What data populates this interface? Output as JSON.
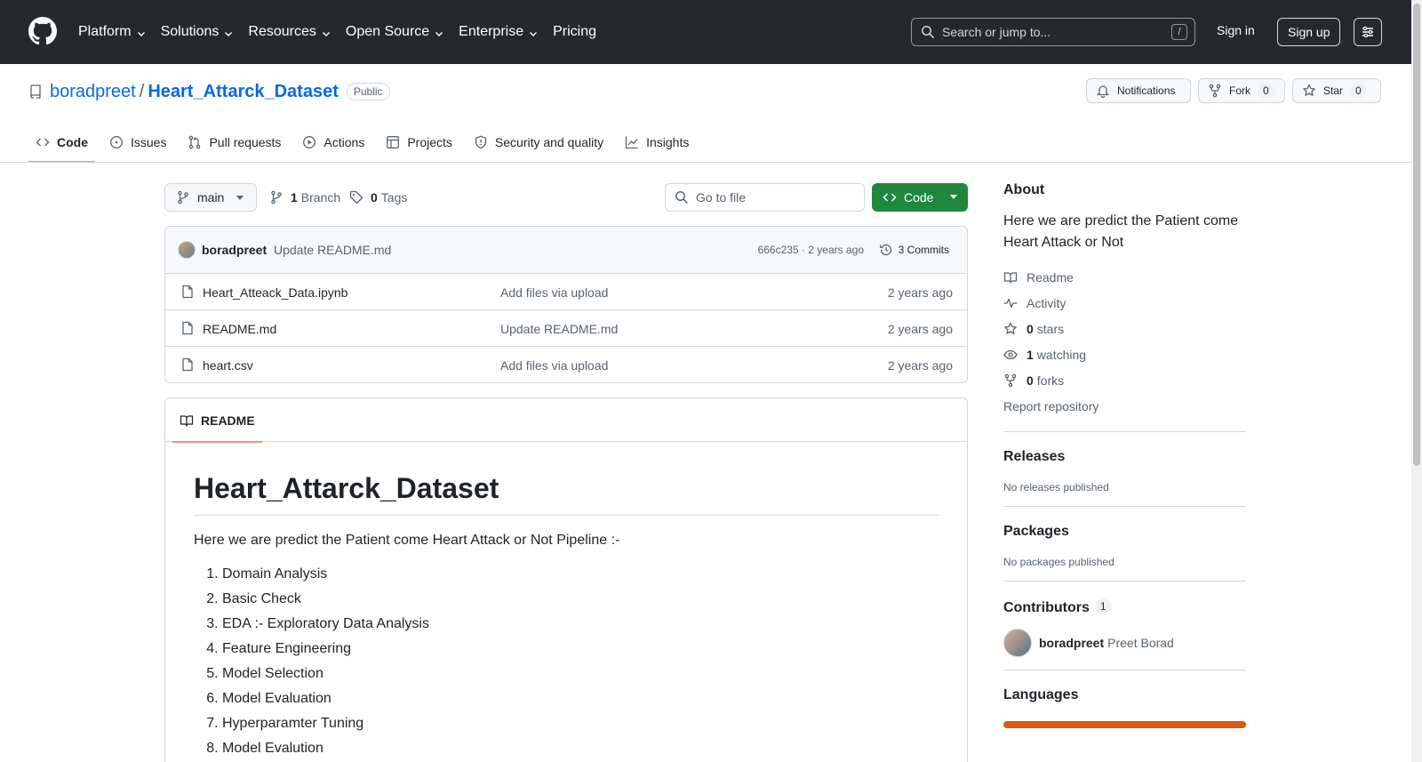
{
  "header": {
    "nav": [
      "Platform",
      "Solutions",
      "Resources",
      "Open Source",
      "Enterprise",
      "Pricing"
    ],
    "search_placeholder": "Search or jump to...",
    "search_key": "/",
    "sign_in": "Sign in",
    "sign_up": "Sign up"
  },
  "repo": {
    "owner": "boradpreet",
    "separator": "/",
    "name": "Heart_Attarck_Dataset",
    "visibility": "Public",
    "notifications": "Notifications",
    "fork_label": "Fork",
    "fork_count": "0",
    "star_label": "Star",
    "star_count": "0"
  },
  "tabs": [
    "Code",
    "Issues",
    "Pull requests",
    "Actions",
    "Projects",
    "Security and quality",
    "Insights"
  ],
  "branch": {
    "name": "main",
    "branch_count": "1",
    "branch_label": "Branch",
    "tag_count": "0",
    "tag_label": "Tags",
    "goto_placeholder": "Go to file",
    "code_button": "Code"
  },
  "commit": {
    "author": "boradpreet",
    "message": "Update README.md",
    "hash_time": "666c235 · 2 years ago",
    "commits": "3 Commits"
  },
  "files": [
    {
      "name": "Heart_Atteack_Data.ipynb",
      "commit": "Add files via upload",
      "age": "2 years ago"
    },
    {
      "name": "README.md",
      "commit": "Update README.md",
      "age": "2 years ago"
    },
    {
      "name": "heart.csv",
      "commit": "Add files via upload",
      "age": "2 years ago"
    }
  ],
  "readme": {
    "tab": "README",
    "title": "Heart_Attarck_Dataset",
    "paragraph": "Here we are predict the Patient come Heart Attack or Not Pipeline :-",
    "list": [
      "Domain Analysis",
      "Basic Check",
      "EDA :- Exploratory Data Analysis",
      "Feature Engineering",
      "Model Selection",
      "Model Evaluation",
      "Hyperparamter Tuning",
      "Model Evalution"
    ]
  },
  "sidebar": {
    "about_title": "About",
    "about_desc": "Here we are predict the Patient come Heart Attack or Not",
    "readme": "Readme",
    "activity": "Activity",
    "stars_count": "0",
    "stars_label": "stars",
    "watching_count": "1",
    "watching_label": "watching",
    "forks_count": "0",
    "forks_label": "forks",
    "report": "Report repository",
    "releases_title": "Releases",
    "releases_text": "No releases published",
    "packages_title": "Packages",
    "packages_text": "No packages published",
    "contributors_title": "Contributors",
    "contributors_count": "1",
    "contributor_login": "boradpreet",
    "contributor_name": "Preet Borad",
    "languages_title": "Languages"
  },
  "colors": {
    "header_bg": "#24292f",
    "link": "#0969da",
    "code_button": "#1f883d",
    "tab_underline": "#fd8c73",
    "language_bar": "#da5b0b"
  }
}
